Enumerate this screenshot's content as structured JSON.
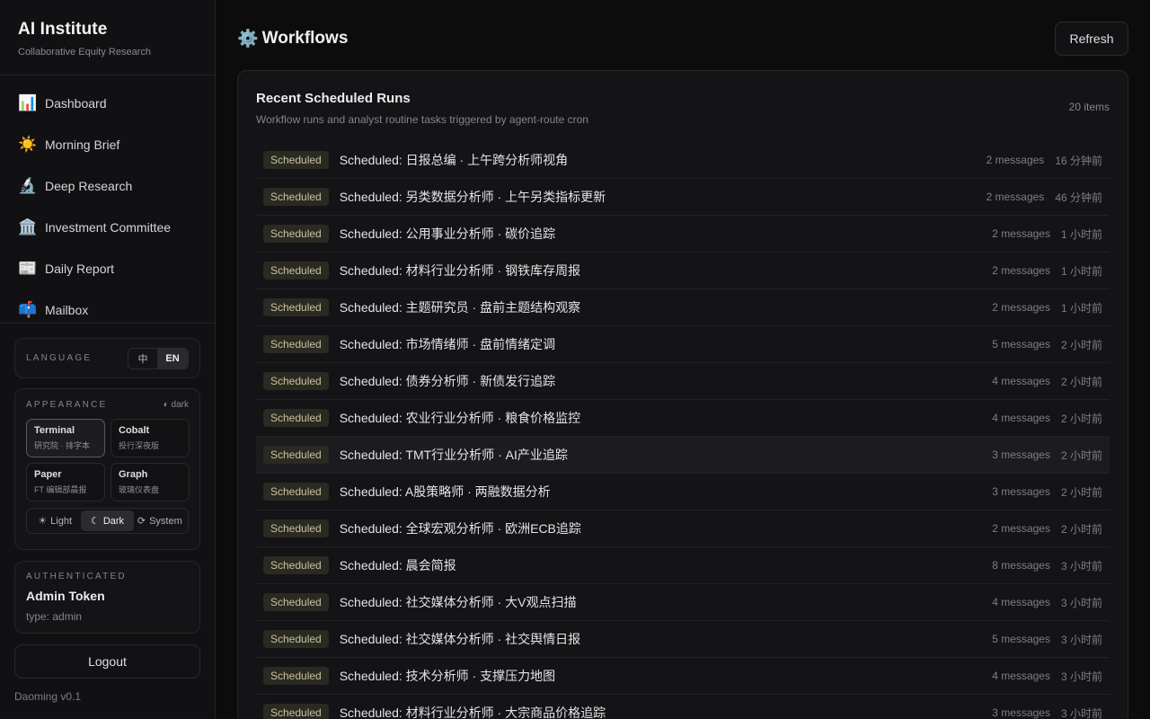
{
  "brand": {
    "title": "AI Institute",
    "subtitle": "Collaborative Equity Research"
  },
  "nav": [
    {
      "icon": "📊",
      "icon_name": "chart-icon",
      "label": "Dashboard"
    },
    {
      "icon": "☀️",
      "icon_name": "sun-icon",
      "label": "Morning Brief"
    },
    {
      "icon": "🔬",
      "icon_name": "microscope-icon",
      "label": "Deep Research"
    },
    {
      "icon": "🏛️",
      "icon_name": "bank-icon",
      "label": "Investment Committee"
    },
    {
      "icon": "📰",
      "icon_name": "newspaper-icon",
      "label": "Daily Report"
    },
    {
      "icon": "📫",
      "icon_name": "mailbox-icon",
      "label": "Mailbox"
    }
  ],
  "language": {
    "label": "LANGUAGE",
    "zh": "中",
    "en": "EN",
    "selected": "EN"
  },
  "appearance": {
    "label": "APPEARANCE",
    "mode_indicator": "◐ dark",
    "themes": [
      {
        "name": "Terminal",
        "desc": "研究院 · 排字本",
        "active": true
      },
      {
        "name": "Cobalt",
        "desc": "投行深夜版",
        "active": false
      },
      {
        "name": "Paper",
        "desc": "FT 编辑部晨报",
        "active": false
      },
      {
        "name": "Graph",
        "desc": "玻璃仪表盘",
        "active": false
      }
    ],
    "modes": [
      {
        "glyph": "☀",
        "label": "Light",
        "active": false
      },
      {
        "glyph": "☾",
        "label": "Dark",
        "active": true
      },
      {
        "glyph": "⟳",
        "label": "System",
        "active": false
      }
    ]
  },
  "auth": {
    "label": "AUTHENTICATED",
    "name": "Admin Token",
    "type": "type: admin"
  },
  "logout_label": "Logout",
  "version": "Daoming v0.1",
  "header": {
    "icon": "⚙️",
    "title": "Workflows",
    "refresh_label": "Refresh"
  },
  "card": {
    "title": "Recent Scheduled Runs",
    "subtitle": "Workflow runs and analyst routine tasks triggered by agent-route cron",
    "count": "20 items"
  },
  "runs": [
    {
      "badge": "Scheduled",
      "title": "Scheduled: 日报总编 · 上午跨分析师视角",
      "messages": "2 messages",
      "time": "16 分钟前"
    },
    {
      "badge": "Scheduled",
      "title": "Scheduled: 另类数据分析师 · 上午另类指标更新",
      "messages": "2 messages",
      "time": "46 分钟前"
    },
    {
      "badge": "Scheduled",
      "title": "Scheduled: 公用事业分析师 · 碳价追踪",
      "messages": "2 messages",
      "time": "1 小时前"
    },
    {
      "badge": "Scheduled",
      "title": "Scheduled: 材料行业分析师 · 钢铁库存周报",
      "messages": "2 messages",
      "time": "1 小时前"
    },
    {
      "badge": "Scheduled",
      "title": "Scheduled: 主题研究员 · 盘前主题结构观察",
      "messages": "2 messages",
      "time": "1 小时前"
    },
    {
      "badge": "Scheduled",
      "title": "Scheduled: 市场情绪师 · 盘前情绪定调",
      "messages": "5 messages",
      "time": "2 小时前"
    },
    {
      "badge": "Scheduled",
      "title": "Scheduled: 债券分析师 · 新债发行追踪",
      "messages": "4 messages",
      "time": "2 小时前"
    },
    {
      "badge": "Scheduled",
      "title": "Scheduled: 农业行业分析师 · 粮食价格监控",
      "messages": "4 messages",
      "time": "2 小时前"
    },
    {
      "badge": "Scheduled",
      "title": "Scheduled: TMT行业分析师 · AI产业追踪",
      "messages": "3 messages",
      "time": "2 小时前"
    },
    {
      "badge": "Scheduled",
      "title": "Scheduled: A股策略师 · 两融数据分析",
      "messages": "3 messages",
      "time": "2 小时前"
    },
    {
      "badge": "Scheduled",
      "title": "Scheduled: 全球宏观分析师 · 欧洲ECB追踪",
      "messages": "2 messages",
      "time": "2 小时前"
    },
    {
      "badge": "Scheduled",
      "title": "Scheduled: 晨会简报",
      "messages": "8 messages",
      "time": "3 小时前"
    },
    {
      "badge": "Scheduled",
      "title": "Scheduled: 社交媒体分析师 · 大V观点扫描",
      "messages": "4 messages",
      "time": "3 小时前"
    },
    {
      "badge": "Scheduled",
      "title": "Scheduled: 社交媒体分析师 · 社交舆情日报",
      "messages": "5 messages",
      "time": "3 小时前"
    },
    {
      "badge": "Scheduled",
      "title": "Scheduled: 技术分析师 · 支撑压力地图",
      "messages": "4 messages",
      "time": "3 小时前"
    },
    {
      "badge": "Scheduled",
      "title": "Scheduled: 材料行业分析师 · 大宗商品价格追踪",
      "messages": "3 messages",
      "time": "3 小时前"
    }
  ]
}
